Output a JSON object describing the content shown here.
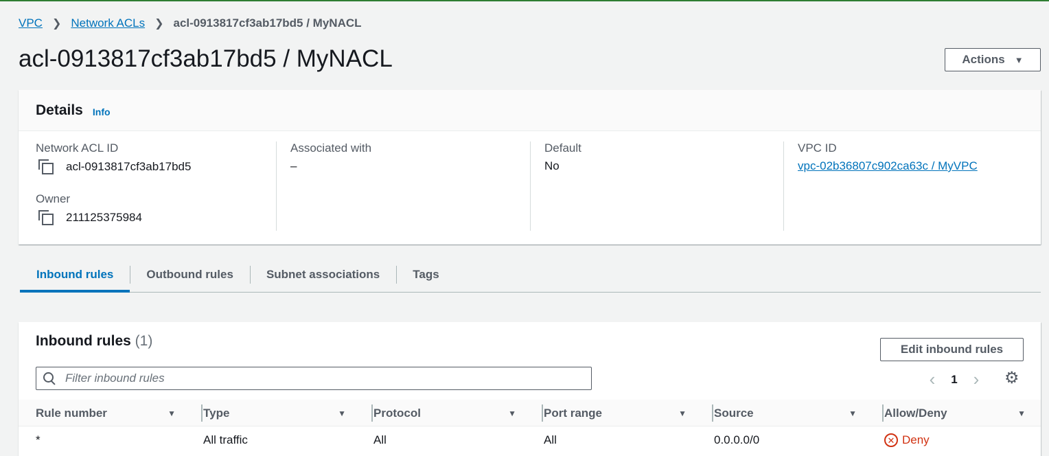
{
  "breadcrumb": {
    "items": [
      "VPC",
      "Network ACLs"
    ],
    "current": "acl-0913817cf3ab17bd5 / MyNACL"
  },
  "page_title": "acl-0913817cf3ab17bd5 / MyNACL",
  "actions_label": "Actions",
  "details": {
    "title": "Details",
    "info_label": "Info",
    "network_acl_id": {
      "label": "Network ACL ID",
      "value": "acl-0913817cf3ab17bd5"
    },
    "owner": {
      "label": "Owner",
      "value": "211125375984"
    },
    "associated_with": {
      "label": "Associated with",
      "value": "–"
    },
    "default": {
      "label": "Default",
      "value": "No"
    },
    "vpc_id": {
      "label": "VPC ID",
      "value": "vpc-02b36807c902ca63c / MyVPC"
    }
  },
  "tabs": [
    {
      "label": "Inbound rules",
      "active": true
    },
    {
      "label": "Outbound rules",
      "active": false
    },
    {
      "label": "Subnet associations",
      "active": false
    },
    {
      "label": "Tags",
      "active": false
    }
  ],
  "inbound": {
    "title": "Inbound rules",
    "count": "(1)",
    "edit_label": "Edit inbound rules",
    "filter_placeholder": "Filter inbound rules",
    "page": "1",
    "columns": [
      "Rule number",
      "Type",
      "Protocol",
      "Port range",
      "Source",
      "Allow/Deny"
    ],
    "rows": [
      {
        "rule_number": "*",
        "type": "All traffic",
        "protocol": "All",
        "port_range": "All",
        "source": "0.0.0.0/0",
        "allow_deny": "Deny"
      }
    ]
  },
  "icons": {
    "copy": "copy-icon",
    "search": "search-icon",
    "settings": "gear-icon",
    "deny": "deny-icon",
    "breadcrumb_separator": "chevron-right-icon",
    "actions_caret": "caret-down-icon",
    "sort": "sort-caret-icon"
  },
  "colors": {
    "link": "#0073bb",
    "deny": "#d13212",
    "background": "#f2f3f3",
    "active_tab": "#0073bb"
  }
}
